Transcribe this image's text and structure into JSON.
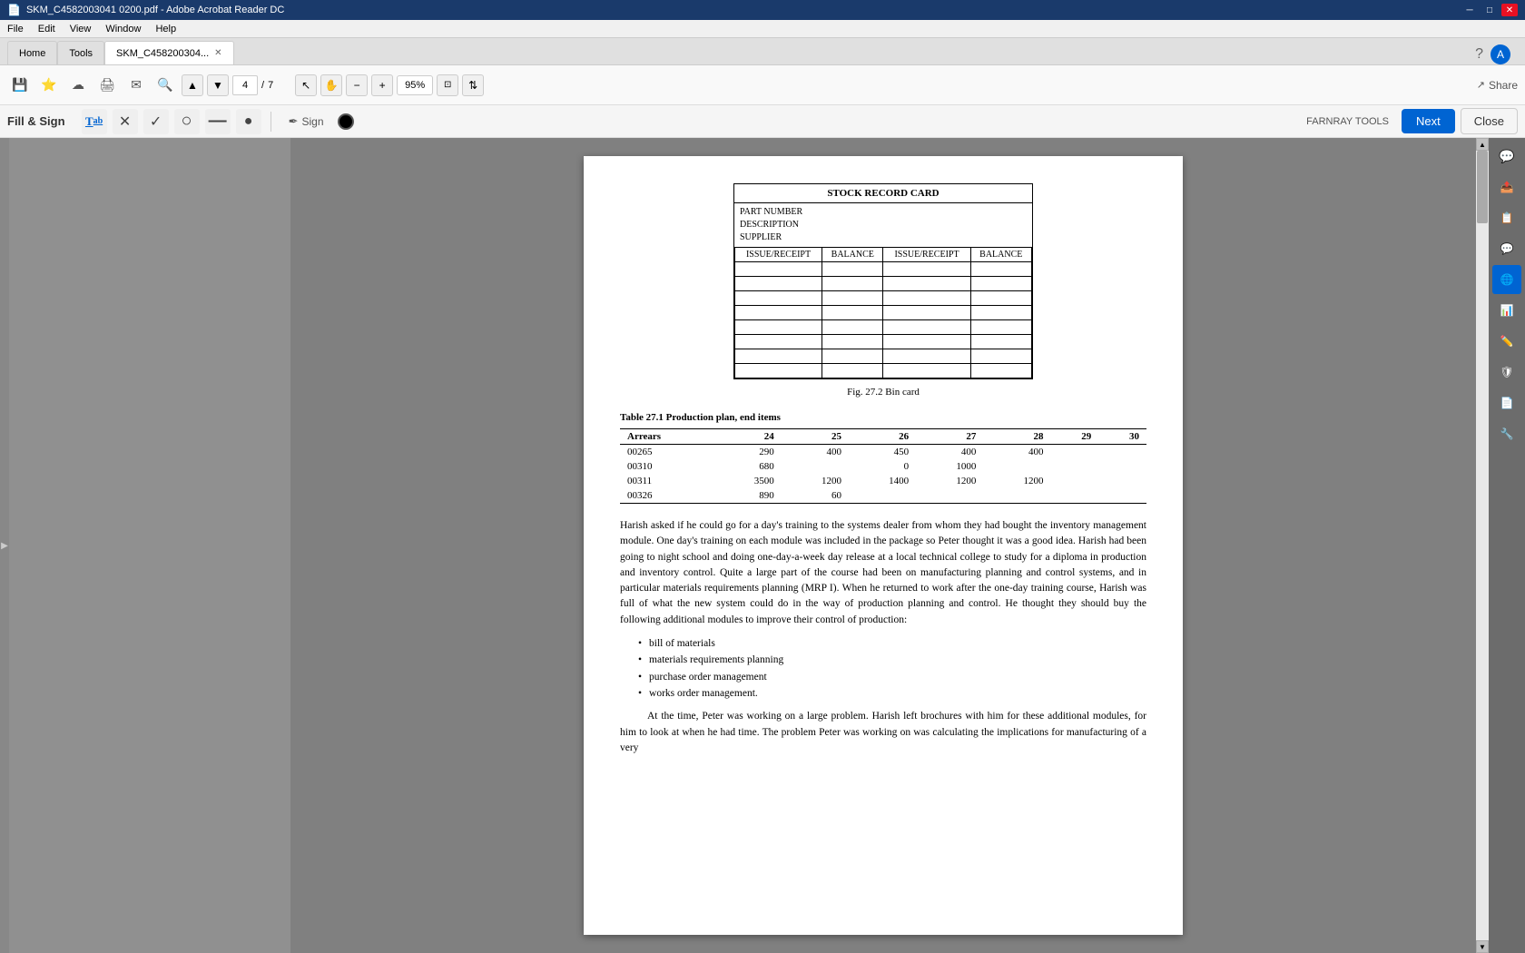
{
  "titlebar": {
    "title": "SKM_C4582003041 0200.pdf - Adobe Acrobat Reader DC",
    "minimize": "─",
    "restore": "□",
    "close": "✕"
  },
  "menubar": {
    "items": [
      "File",
      "Edit",
      "View",
      "Window",
      "Help"
    ]
  },
  "tabs": [
    {
      "label": "Home",
      "active": false,
      "closeable": false
    },
    {
      "label": "Tools",
      "active": false,
      "closeable": false
    },
    {
      "label": "SKM_C458200304...",
      "active": true,
      "closeable": true
    }
  ],
  "toolbar": {
    "page_current": "4",
    "page_total": "7",
    "zoom_value": "95%",
    "share_label": "Share"
  },
  "fill_sign": {
    "label": "Fill & Sign",
    "next_label": "Next",
    "close_label": "Close",
    "farnray_tools": "FARNRAY TOOLS"
  },
  "document": {
    "stock_card": {
      "title": "STOCK RECORD CARD",
      "part_number_label": "PART NUMBER",
      "description_label": "DESCRIPTION",
      "supplier_label": "SUPPLIER",
      "columns": [
        "ISSUE/RECEIPT",
        "BALANCE",
        "ISSUE/RECEIPT",
        "BALANCE"
      ]
    },
    "fig_caption": "Fig. 27.2  Bin card",
    "table_title": "Table 27.1  Production plan, end items",
    "table_headers": [
      "Arrears",
      "24",
      "25",
      "26",
      "27",
      "28",
      "29",
      "30"
    ],
    "table_rows": [
      [
        "00265",
        "290",
        "400",
        "450",
        "400",
        "400",
        "",
        "",
        ""
      ],
      [
        "00310",
        "680",
        "",
        "0",
        "1000",
        "",
        "",
        "",
        ""
      ],
      [
        "00311",
        "3500",
        "1200",
        "1400",
        "1200",
        "1200",
        "",
        "",
        ""
      ],
      [
        "00326",
        "890",
        "60",
        "",
        "",
        "",
        "",
        "",
        ""
      ]
    ],
    "body_text_1": "Harish asked if he could go for a day's training to the systems dealer from whom they had bought the inventory management module. One day's training on each module was included in the package so Peter thought it was a good idea. Harish had been going to night school and doing one-day-a-week day release at a local technical college to study for a diploma in production and inventory control. Quite a large part of the course had been on manufacturing planning and control systems, and in particular materials requirements planning (MRP I). When he returned to work after the one-day training course, Harish was full of what the new system could do in the way of production planning and control. He thought they should buy the following additional modules to improve their control of production:",
    "bullet_items": [
      "bill of materials",
      "materials requirements planning",
      "purchase order management",
      "works order management."
    ],
    "body_text_2": "At the time, Peter was working on a large problem. Harish left brochures with him for these additional modules, for him to look at when he had time. The problem Peter was working on was calculating the implications for manufacturing of a very"
  },
  "right_sidebar_icons": [
    "comment-icon",
    "pdf-icon",
    "bookmark-icon",
    "translate-icon",
    "chart-icon",
    "edit-icon",
    "shield-icon",
    "export-icon",
    "settings-icon"
  ],
  "colors": {
    "accent_blue": "#0064d2",
    "title_bar": "#1a3a6b",
    "toolbar_bg": "#f9f9f9"
  }
}
